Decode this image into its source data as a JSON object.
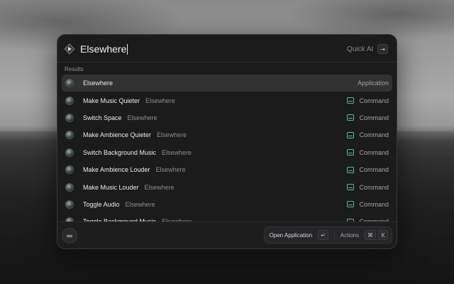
{
  "search": {
    "query": "Elsewhere",
    "quick_ai_label": "Quick AI",
    "quick_ai_key": "⇥"
  },
  "results": {
    "section_label": "Results",
    "items": [
      {
        "title": "Elsewhere",
        "subtitle": "",
        "type": "Application",
        "selected": true
      },
      {
        "title": "Make Music Quieter",
        "subtitle": "Elsewhere",
        "type": "Command"
      },
      {
        "title": "Switch Space",
        "subtitle": "Elsewhere",
        "type": "Command"
      },
      {
        "title": "Make Ambience Quieter",
        "subtitle": "Elsewhere",
        "type": "Command"
      },
      {
        "title": "Switch Background Music",
        "subtitle": "Elsewhere",
        "type": "Command"
      },
      {
        "title": "Make Ambience Louder",
        "subtitle": "Elsewhere",
        "type": "Command"
      },
      {
        "title": "Make Music Louder",
        "subtitle": "Elsewhere",
        "type": "Command"
      },
      {
        "title": "Toggle Audio",
        "subtitle": "Elsewhere",
        "type": "Command"
      },
      {
        "title": "Toggle Background Music",
        "subtitle": "Elsewhere",
        "type": "Command"
      }
    ]
  },
  "footer": {
    "primary_action": "Open Application",
    "primary_key": "↵",
    "actions_label": "Actions",
    "actions_keys": [
      "⌘",
      "K"
    ]
  },
  "colors": {
    "command_icon": "#58b5a4",
    "selected_row": "#323234",
    "panel_bg": "#1b1b1c"
  }
}
